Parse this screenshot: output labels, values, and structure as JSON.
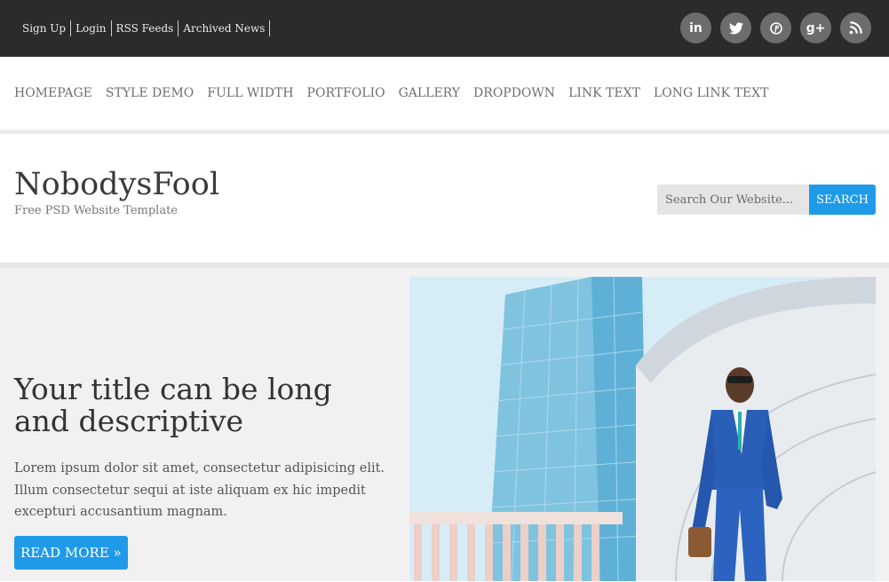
{
  "topbar": {
    "links": [
      "Sign Up",
      "Login",
      "RSS Feeds",
      "Archived News"
    ],
    "social": [
      {
        "icon": "linkedin-icon",
        "glyph": "in"
      },
      {
        "icon": "twitter-icon",
        "glyph": ""
      },
      {
        "icon": "pinterest-icon",
        "glyph": ""
      },
      {
        "icon": "google-plus-icon",
        "glyph": "g+"
      },
      {
        "icon": "rss-icon",
        "glyph": ""
      }
    ]
  },
  "nav": {
    "items": [
      "HOMEPAGE",
      "STYLE DEMO",
      "FULL WIDTH",
      "PORTFOLIO",
      "GALLERY",
      "DROPDOWN",
      "LINK TEXT",
      "LONG LINK TEXT"
    ]
  },
  "header": {
    "logo": "NobodysFool",
    "tagline": "Free PSD Website Template",
    "search_placeholder": "Search Our Website...",
    "search_button": "SEARCH"
  },
  "hero": {
    "title": "Your title can be long and descriptive",
    "text": "Lorem ipsum dolor sit amet, consectetur adipisicing elit. Illum consectetur sequi at iste aliquam ex hic impedit excepturi accusantium magnam.",
    "button": "READ MORE »"
  },
  "colors": {
    "topbar_bg": "#2b2b2b",
    "social_bg": "#6c6c6c",
    "accent": "#1f9ae8",
    "hero_bg": "#f1f1f1"
  }
}
